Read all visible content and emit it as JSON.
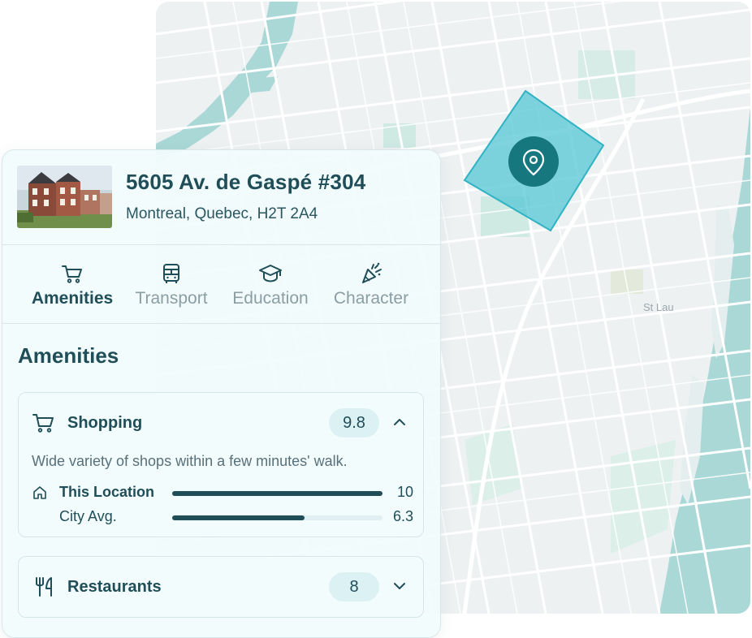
{
  "map": {
    "place_label": "St Lau",
    "pin_icon": "location-pin-icon",
    "colors": {
      "water": "#a9d8d6",
      "land": "#eef1f2",
      "roads": "#ffffff",
      "selection": "#4ec3d2",
      "pin": "#16777f"
    }
  },
  "listing": {
    "address": "5605 Av. de Gaspé #304",
    "city": "Montreal, Quebec, H2T 2A4"
  },
  "tabs": [
    {
      "label": "Amenities",
      "icon": "cart-icon",
      "active": true
    },
    {
      "label": "Transport",
      "icon": "bus-icon",
      "active": false
    },
    {
      "label": "Education",
      "icon": "graduation-cap-icon",
      "active": false
    },
    {
      "label": "Character",
      "icon": "party-popper-icon",
      "active": false
    }
  ],
  "section": {
    "title": "Amenities"
  },
  "categories": [
    {
      "title": "Shopping",
      "icon": "cart-icon",
      "score": "9.8",
      "expanded": true,
      "description": "Wide variety of shops within a few minutes' walk.",
      "comparisons": [
        {
          "label": "This Location",
          "value": "10",
          "fraction": 1.0
        },
        {
          "label": "City Avg.",
          "value": "6.3",
          "fraction": 0.63
        }
      ]
    },
    {
      "title": "Restaurants",
      "icon": "fork-knife-icon",
      "score": "8",
      "expanded": false
    }
  ],
  "colors": {
    "primary": "#1f4e58",
    "muted": "#8a9ea3",
    "score_bg": "#dcf1f3"
  }
}
